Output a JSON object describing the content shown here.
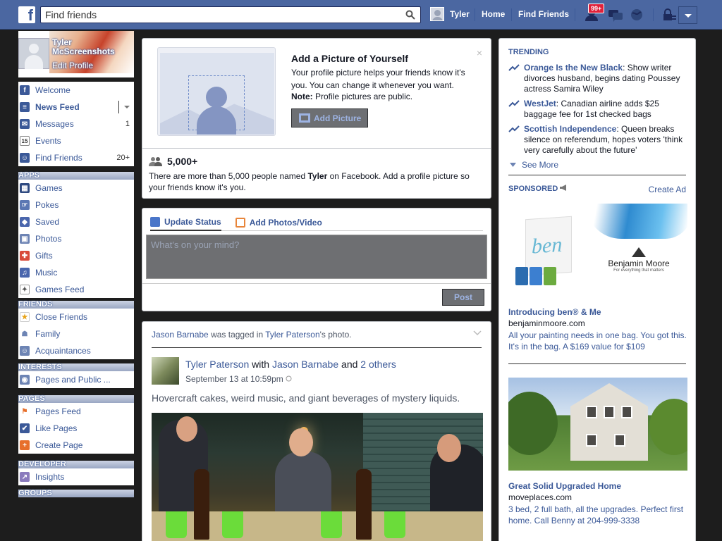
{
  "topbar": {
    "logo": "f",
    "search_placeholder": "Find friends",
    "user_name": "Tyler",
    "home": "Home",
    "find_friends": "Find Friends",
    "notif_count": "99+",
    "brand_color": "#4b67a1"
  },
  "profile": {
    "name": "Tyler McScreenshots",
    "edit": "Edit Profile"
  },
  "nav": {
    "main": [
      {
        "label": "Welcome",
        "icon": "facebook-icon",
        "color": "#3b5998"
      },
      {
        "label": "News Feed",
        "icon": "news-feed-icon",
        "color": "#3b5998"
      },
      {
        "label": "Messages",
        "icon": "messages-icon",
        "color": "#3b5998",
        "count": "1"
      },
      {
        "label": "Events",
        "icon": "calendar-icon",
        "color": "#fff",
        "badge": "15"
      },
      {
        "label": "Find Friends",
        "icon": "friends-icon",
        "color": "#3b5998",
        "count": "20+"
      }
    ],
    "apps_header": "APPS",
    "apps": [
      {
        "label": "Games",
        "icon": "games-icon"
      },
      {
        "label": "Pokes",
        "icon": "pokes-icon"
      },
      {
        "label": "Saved",
        "icon": "saved-icon"
      },
      {
        "label": "Photos",
        "icon": "photos-icon"
      },
      {
        "label": "Gifts",
        "icon": "gift-icon"
      },
      {
        "label": "Music",
        "icon": "music-icon"
      },
      {
        "label": "Games Feed",
        "icon": "controller-icon"
      }
    ],
    "friends_header": "FRIENDS",
    "friends": [
      {
        "label": "Close Friends",
        "icon": "star-icon"
      },
      {
        "label": "Family",
        "icon": "family-icon"
      },
      {
        "label": "Acquaintances",
        "icon": "acquaintances-icon"
      }
    ],
    "interests_header": "INTERESTS",
    "interests": [
      {
        "label": "Pages and Public ...",
        "icon": "rss-icon"
      }
    ],
    "pages_header": "PAGES",
    "pages": [
      {
        "label": "Pages Feed",
        "icon": "pages-feed-icon"
      },
      {
        "label": "Like Pages",
        "icon": "like-icon"
      },
      {
        "label": "Create Page",
        "icon": "create-page-icon"
      }
    ],
    "developer_header": "DEVELOPER",
    "developer": [
      {
        "label": "Insights",
        "icon": "insights-icon"
      }
    ],
    "groups_header": "GROUPS"
  },
  "profile_prompt": {
    "title": "Add a Picture of Yourself",
    "text": "Your profile picture helps your friends know it's you. You can change it whenever you want.",
    "note_label": "Note:",
    "note_text": " Profile pictures are public.",
    "button": "Add Picture",
    "close": "×",
    "count": "5,000+",
    "desc_pre": "There are more than 5,000 people named ",
    "desc_name": "Tyler",
    "desc_post": " on Facebook. Add a profile picture so your friends know it's you."
  },
  "composer": {
    "tab_status": "Update Status",
    "tab_photos": "Add Photos/Video",
    "placeholder": "What's on your mind?",
    "post": "Post"
  },
  "story": {
    "head_actor": "Jason Barnabe",
    "head_mid": " was tagged in ",
    "head_target": "Tyler Paterson",
    "head_suffix": "'s photo.",
    "author": "Tyler Paterson",
    "with": " with ",
    "tagged": "Jason Barnabe",
    "and": " and ",
    "others": "2 others",
    "time": "September 13 at 10:59pm",
    "text": "Hovercraft cakes, weird music, and giant beverages of mystery liquids."
  },
  "sidebar_right": {
    "trending_header": "TRENDING",
    "trending": [
      {
        "topic": "Orange Is the New Black",
        "desc": ": Show writer divorces husband, begins dating Poussey actress Samira Wiley"
      },
      {
        "topic": "WestJet",
        "desc": ": Canadian airline adds $25 baggage fee for 1st checked bags"
      },
      {
        "topic": "Scottish Independence",
        "desc": ": Queen breaks silence on referendum, hopes voters 'think very carefully about the future'"
      }
    ],
    "see_more": "See More",
    "sponsored_header": "SPONSORED",
    "create_ad": "Create Ad",
    "ad1": {
      "bag_text": "ben",
      "brand": "Benjamin Moore",
      "brand_tag": "For everything that matters",
      "title": "Introducing ben® & Me",
      "url": "benjaminmoore.com",
      "desc": "All your painting needs in one bag. You got this. It's in the bag. A $169 value for $109"
    },
    "ad2": {
      "title": "Great Solid Upgraded Home",
      "url": "moveplaces.com",
      "desc": "3 bed, 2 full bath, all the upgrades. Perfect first home. Call Benny at 204-999-3338"
    }
  }
}
